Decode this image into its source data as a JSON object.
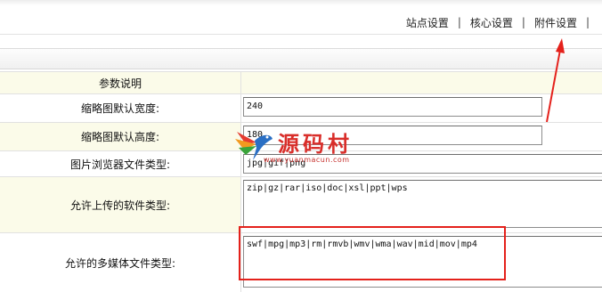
{
  "nav": {
    "tabs": [
      {
        "label": "站点设置"
      },
      {
        "label": "核心设置"
      },
      {
        "label": "附件设置"
      }
    ],
    "separator": "|"
  },
  "form": {
    "header_label": "参数说明",
    "rows": [
      {
        "label": "缩略图默认宽度:",
        "value": "240"
      },
      {
        "label": "缩略图默认高度:",
        "value": "180"
      },
      {
        "label": "图片浏览器文件类型:",
        "value": "jpg|gif|png"
      },
      {
        "label": "允许上传的软件类型:",
        "value": "zip|gz|rar|iso|doc|xsl|ppt|wps"
      },
      {
        "label": "允许的多媒体文件类型:",
        "value": "swf|mpg|mp3|rm|rmvb|wmv|wma|wav|mid|mov|mp4"
      }
    ]
  },
  "watermark": {
    "title": "源码村",
    "url": "www.yuanmacun.com"
  },
  "colors": {
    "annotation": "#e4211b",
    "label_bg": "#fbfbe9"
  }
}
